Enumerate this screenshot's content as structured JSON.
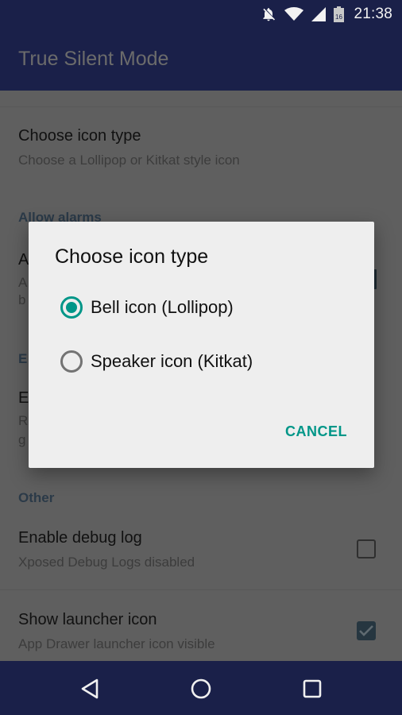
{
  "status_bar": {
    "time": "21:38",
    "battery_level": "16",
    "icons": [
      "notifications-off-icon",
      "wifi-icon",
      "cell-signal-icon",
      "battery-icon"
    ]
  },
  "app_bar": {
    "title": "True Silent Mode"
  },
  "preferences": {
    "choose_icon": {
      "title": "Choose icon type",
      "summary": "Choose a Lollipop or Kitkat style icon"
    },
    "section_allow_alarms": "Allow alarms",
    "allow_alarms_item": {
      "title_visible": "A",
      "summary_line1_visible": "A",
      "summary_line2_visible": "b"
    },
    "section_e": "E",
    "e_item": {
      "title_visible": "E",
      "summary_line1_visible": "R",
      "summary_line2_visible": "g"
    },
    "section_other": "Other",
    "debug_log": {
      "title": "Enable debug log",
      "summary": "Xposed Debug Logs disabled",
      "checked": false
    },
    "launcher_icon": {
      "title": "Show launcher icon",
      "summary": "App Drawer launcher icon visible",
      "checked": true
    }
  },
  "dialog": {
    "title": "Choose icon type",
    "options": [
      {
        "label": "Bell icon (Lollipop)",
        "selected": true
      },
      {
        "label": "Speaker icon (Kitkat)",
        "selected": false
      }
    ],
    "cancel_label": "CANCEL",
    "accent_color": "#009688"
  },
  "nav_bar": {
    "buttons": [
      "back",
      "home",
      "recents"
    ]
  }
}
